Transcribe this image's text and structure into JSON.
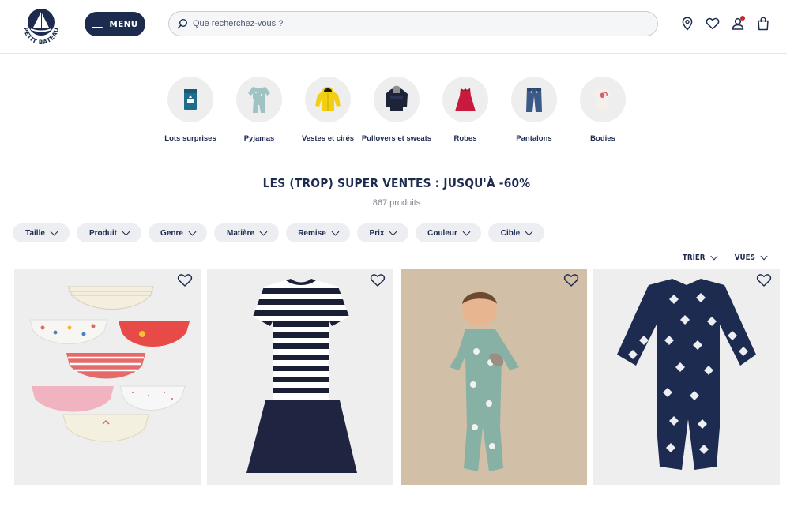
{
  "brand": {
    "name": "Petit Bateau",
    "logo_text": "PETIT BATEAU"
  },
  "header": {
    "menu_label": "MENU",
    "search_placeholder": "Que recherchez-vous ?",
    "icons": [
      "location-icon",
      "heart-icon",
      "account-icon",
      "bag-icon"
    ]
  },
  "categories": [
    {
      "label": "Lots surprises"
    },
    {
      "label": "Pyjamas"
    },
    {
      "label": "Vestes et cirés"
    },
    {
      "label": "Pullovers et sweats"
    },
    {
      "label": "Robes"
    },
    {
      "label": "Pantalons"
    },
    {
      "label": "Bodies"
    }
  ],
  "listing": {
    "title": "LES (TROP) SUPER VENTES : JUSQU'À -60%",
    "count": "867 produits"
  },
  "filters": [
    "Taille",
    "Produit",
    "Genre",
    "Matière",
    "Remise",
    "Prix",
    "Couleur",
    "Cible"
  ],
  "sort": {
    "sort_label": "TRIER",
    "views_label": "VUES"
  },
  "products": [
    {
      "name": "Lot de culottes",
      "bg": "#eeeeef"
    },
    {
      "name": "Robe marinière",
      "bg": "#eeeeef"
    },
    {
      "name": "Pyjama vert bébé",
      "bg": "#d2bfa8"
    },
    {
      "name": "Pyjama bleu marine",
      "bg": "#eeeeef"
    }
  ],
  "colors": {
    "navy": "#1d2b4f",
    "chip_bg": "#edeef1",
    "notif": "#c1272d"
  }
}
